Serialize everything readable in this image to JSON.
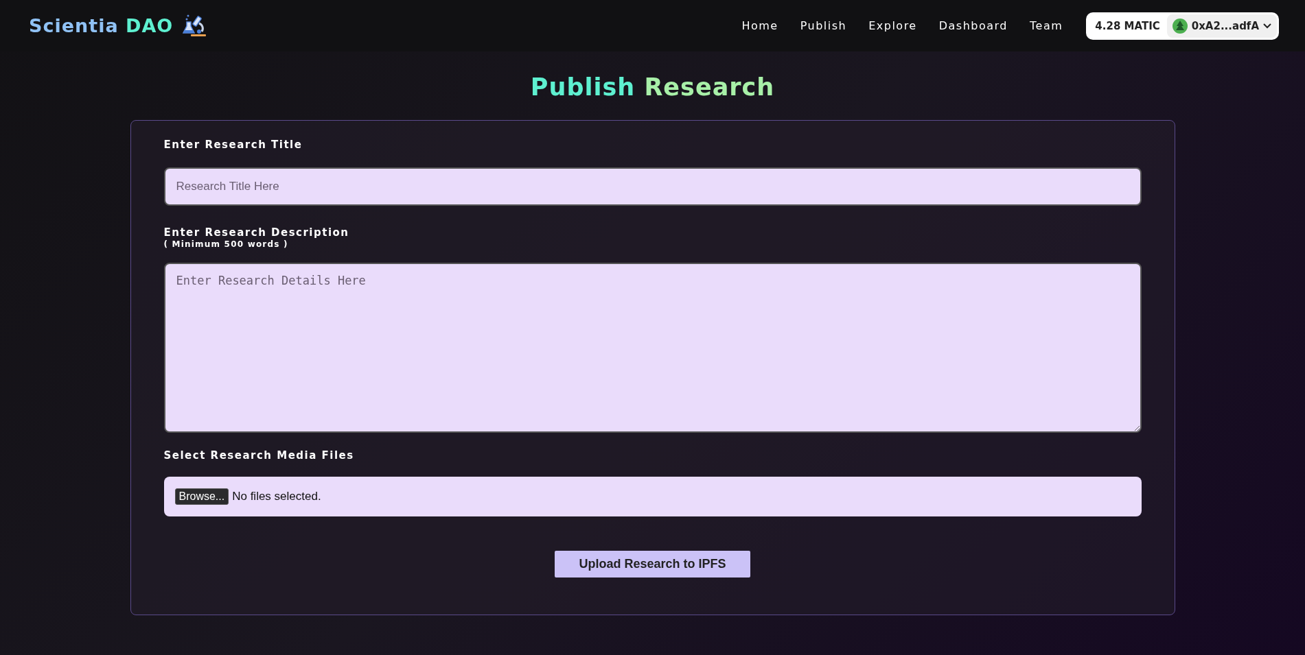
{
  "brand": {
    "name": "Scientia",
    "accent": "DAO"
  },
  "nav": [
    {
      "label": "Home"
    },
    {
      "label": "Publish"
    },
    {
      "label": "Explore"
    },
    {
      "label": "Dashboard"
    },
    {
      "label": "Team"
    }
  ],
  "wallet": {
    "balance": "4.28 MATIC",
    "address": "0xA2...adfA"
  },
  "page_title": {
    "first": "Publish",
    "second": "Research"
  },
  "form": {
    "title_label": "Enter Research Title",
    "title_placeholder": "Research Title Here",
    "description_label": "Enter Research Description",
    "description_note": "( Minimum 500 words )",
    "description_placeholder": "Enter Research Details Here",
    "media_label": "Select Research Media Files",
    "browse_button": "Browse...",
    "file_status": "No files selected.",
    "submit": "Upload Research to IPFS"
  }
}
